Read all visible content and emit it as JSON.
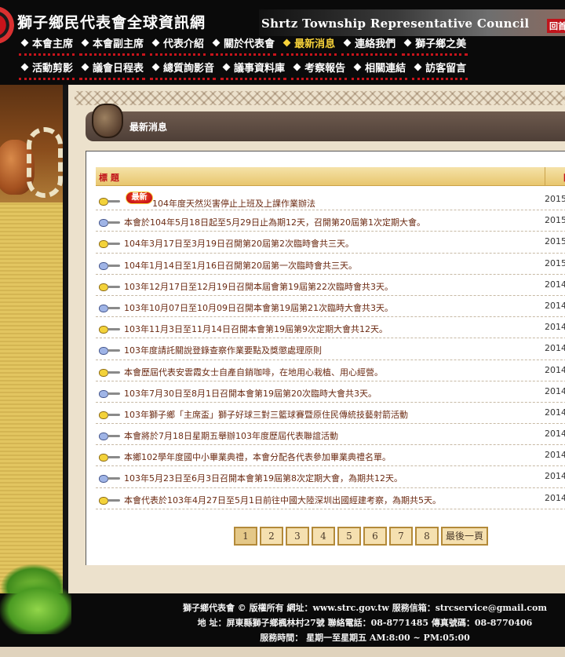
{
  "header": {
    "title_zh": "獅子鄉民代表會全球資訊網",
    "title_en": "Shrtz Township Representative Council",
    "home_tag": "回首",
    "nav_row_1": [
      "本會主席",
      "本會副主席",
      "代表介紹",
      "關於代表會",
      "最新消息",
      "連絡我們",
      "獅子鄉之美"
    ],
    "nav_row_2": [
      "活動剪影",
      "議會日程表",
      "總質詢影音",
      "議事資料庫",
      "考察報告",
      "相關連結",
      "訪客留言"
    ],
    "active_nav": "最新消息",
    "colors": {
      "background": "#0a0a0a",
      "text": "#ffffff",
      "active": "#f7d23a",
      "accent": "#c8141b"
    }
  },
  "section": {
    "title": "最新消息",
    "icon": "vase-icon"
  },
  "news_table": {
    "col_title": "標 題",
    "col_date": "日",
    "rows": [
      {
        "title": "104年度天然災害停止上班及上課作業辦法",
        "date": "2015",
        "badge": "最新",
        "icon": "pointer-hand-icon"
      },
      {
        "title": "本會於104年5月18日起至5月29日止為期12天，召開第20屆第1次定期大會。",
        "date": "2015",
        "icon": "pointer-hand-icon"
      },
      {
        "title": "104年3月17日至3月19日召開第20屆第2次臨時會共三天。",
        "date": "2015",
        "icon": "pointer-hand-icon"
      },
      {
        "title": "104年1月14日至1月16日召開第20屆第一次臨時會共三天。",
        "date": "2015",
        "icon": "pointer-hand-icon"
      },
      {
        "title": "103年12月17日至12月19日召開本屆會第19屆第22次臨時會共3天。",
        "date": "2014",
        "icon": "pointer-hand-icon"
      },
      {
        "title": " 103年10月07日至10月09日召開本會第19屆第21次臨時大會共3天。",
        "date": "2014",
        "icon": "pointer-hand-icon"
      },
      {
        "title": "103年11月3日至11月14日召開本會第19屆第9次定期大會共12天。",
        "date": "2014",
        "icon": "pointer-hand-icon"
      },
      {
        "title": "103年度請託關說登錄查察作業要點及獎懲處理原則",
        "date": "2014",
        "icon": "pointer-hand-icon"
      },
      {
        "title": "本會歷屆代表安雲霞女士自產自銷咖啡，在地用心栽植、用心經營。",
        "date": "2014",
        "icon": "pointer-hand-icon"
      },
      {
        "title": "103年7月30日至8月1日召開本會第19屆第20次臨時大會共3天。",
        "date": "2014",
        "icon": "pointer-hand-icon"
      },
      {
        "title": "103年獅子鄉「主席盃」獅子好球三對三籃球賽暨原住民傳統技藝射箭活動",
        "date": "2014",
        "icon": "pointer-hand-icon"
      },
      {
        "title": "本會將於7月18日星期五舉辦103年度歷屆代表聯誼活動",
        "date": "2014",
        "icon": "pointer-hand-icon"
      },
      {
        "title": "本鄉102學年度國中小畢業典禮，本會分配各代表參加畢業典禮名單。",
        "date": "2014",
        "icon": "pointer-hand-icon"
      },
      {
        "title": "103年5月23日至6月3日召開本會第19屆第8次定期大會，為期共12天。",
        "date": "2014",
        "icon": "pointer-hand-icon"
      },
      {
        "title": "本會代表於103年4月27日至5月1日前往中國大陸深圳出國經建考察，為期共5天。",
        "date": "2014",
        "icon": "pointer-hand-icon"
      }
    ]
  },
  "pagination": {
    "pages": [
      "1",
      "2",
      "3",
      "4",
      "5",
      "6",
      "7",
      "8"
    ],
    "current": "1",
    "last_label": "最後一頁"
  },
  "footer": {
    "line1": "獅子鄉代表會 © 版權所有 網址：www.strc.gov.tw 服務信箱：strcservice@gmail.com",
    "line2": "地 址：屏東縣獅子鄉楓林村27號 聯絡電話：08-8771485 傳真號碼：08-8770406",
    "line3": "服務時間： 星期一至星期五 AM:8:00 ~ PM:05:00"
  }
}
